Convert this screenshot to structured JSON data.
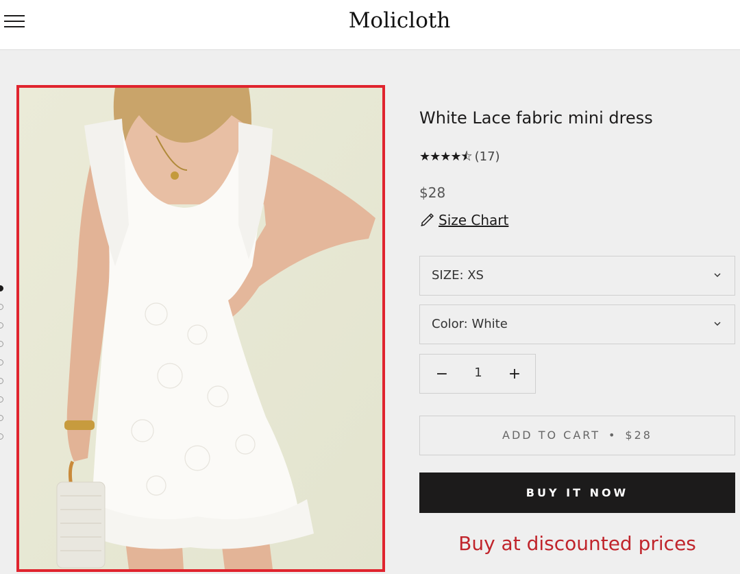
{
  "header": {
    "brand": "Molicloth",
    "menu_icon": "hamburger-menu-icon"
  },
  "gallery": {
    "slide_count": 9,
    "active_index": 0
  },
  "product": {
    "title": "White Lace fabric mini dress",
    "rating_stars": "★★★★⯪",
    "rating": 4.5,
    "rating_count": "(17)",
    "price": "$28",
    "size_chart_label": "Size Chart",
    "size_chart_icon": "ruler-pencil-icon"
  },
  "options": {
    "size_label": "SIZE: XS",
    "color_label": "Color: White",
    "chevron_icon": "chevron-down-icon"
  },
  "quantity": {
    "value": "1",
    "minus": "−",
    "plus": "+"
  },
  "actions": {
    "add_to_cart": "ADD TO CART",
    "separator": "•",
    "add_to_cart_price": "$28",
    "buy_now": "BUY IT NOW"
  },
  "promo": {
    "text": "Buy at discounted prices",
    "color": "#c0242b"
  },
  "colors": {
    "accent_border": "#e0242e",
    "button_dark": "#1c1b1b",
    "background": "#efefef"
  }
}
